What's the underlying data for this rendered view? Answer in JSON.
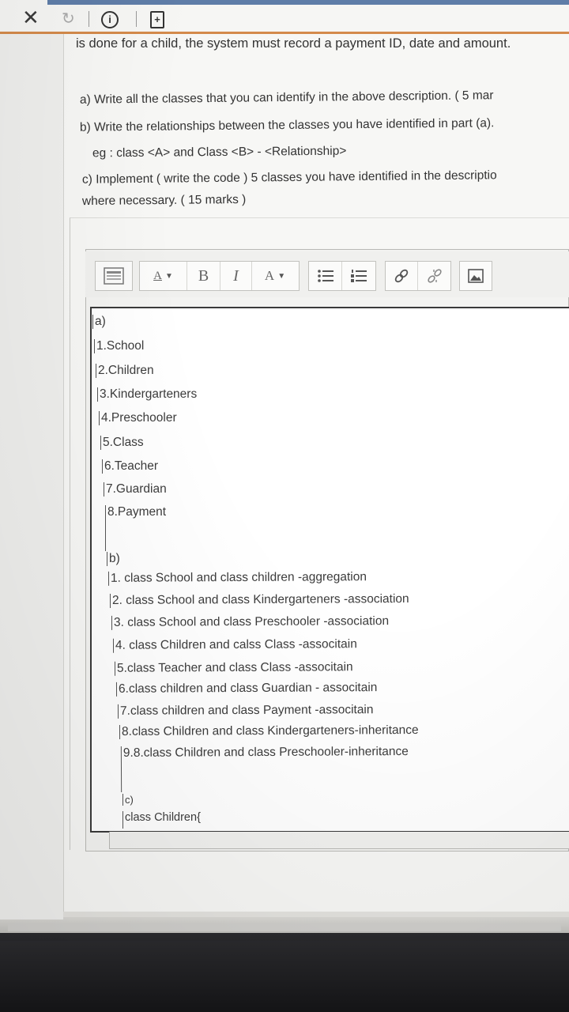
{
  "toolbar_top": {
    "icons": [
      "close-icon",
      "refresh-icon",
      "info-icon",
      "document-icon"
    ],
    "close_glyph": "✕",
    "refresh_glyph": "↻",
    "info_glyph": "i",
    "doc_glyph": "+"
  },
  "question": {
    "intro_line": "is done for a child, the system must record a payment ID, date and amount.",
    "part_a": "a) Write all the classes that you can identify in the above description.  ( 5 mar",
    "part_b": "b) Write the relationships between the classes you have identified in part (a).",
    "example": "eg :  class <A> and Class <B> -  <Relationship>",
    "part_c_line1": "c) Implement ( write the code ) 5 classes you have identified in the descriptio",
    "part_c_line2": "where necessary.  ( 15 marks )"
  },
  "editor_toolbar": {
    "font_size_label": "A",
    "bold_label": "B",
    "italic_label": "I",
    "font_color_label": "A"
  },
  "answer": {
    "a_heading": "a)",
    "a_items": [
      "1.School",
      "2.Children",
      "3.Kindergarteners",
      "4.Preschooler",
      "5.Class",
      "6.Teacher",
      "7.Guardian",
      "8.Payment"
    ],
    "b_heading": "b)",
    "b_items": [
      "1. class School and class children -aggregation",
      "2. class School and class Kindergarteners -association",
      "3. class School and class Preschooler -association",
      "4. class Children and calss Class -associtain",
      "5.class Teacher and class Class -associtain",
      "6.class children and class Guardian - associtain",
      "7.class children and class Payment -associtain",
      "8.class Children and class Kindergarteners-inheritance",
      "9.8.class Children and class Preschooler-inheritance"
    ],
    "c_heading": "c)",
    "c_code_line": "class Children{"
  },
  "colors": {
    "accent_blue": "#5f7da8",
    "accent_orange": "#d48a4b"
  }
}
